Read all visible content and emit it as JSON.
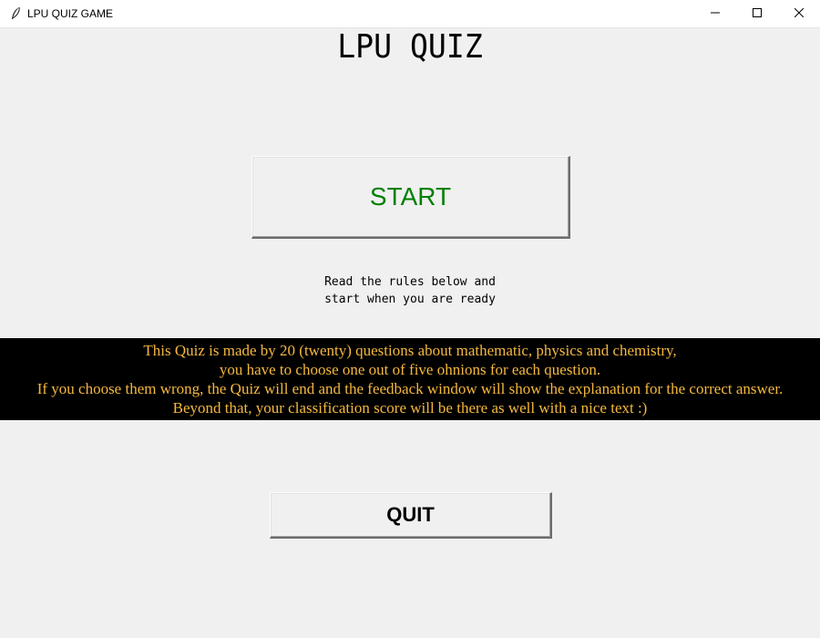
{
  "window": {
    "title": "LPU QUIZ GAME",
    "icon": "feather-icon",
    "controls": [
      "minimize-icon",
      "maximize-icon",
      "close-icon"
    ]
  },
  "heading": "LPU QUIZ",
  "start_button": {
    "label": "START",
    "color": "#008000"
  },
  "instructions": {
    "line1": "Read the rules below and",
    "line2": "start when you are ready"
  },
  "rules": {
    "text_color": "#f5b83d",
    "background": "#000000",
    "lines": [
      "This Quiz is made by 20 (twenty) questions about mathematic, physics and chemistry,",
      "you have to choose one out of five ohnions for each question.",
      "If you choose them wrong, the Quiz will end and the feedback window will show the explanation for the correct answer.",
      "Beyond that, your classification score will be there as well with a nice text :)"
    ]
  },
  "quit_button": {
    "label": "QUIT"
  }
}
